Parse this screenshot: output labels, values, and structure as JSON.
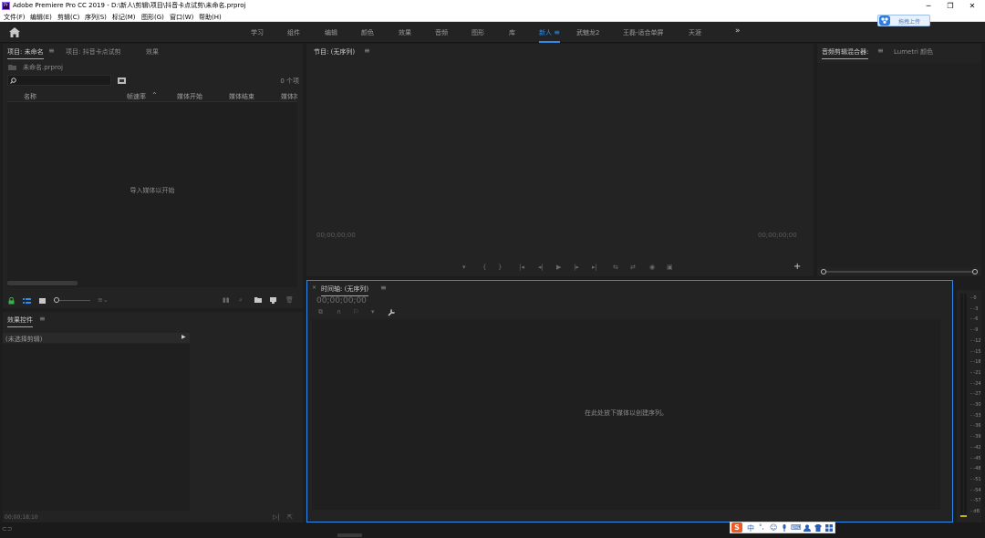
{
  "window": {
    "title": "Adobe Premiere Pro CC 2019 - D:\\新人\\剪辑\\项目\\抖音卡点试剪\\未命名.prproj",
    "app_icon": "Pr",
    "controls": {
      "minimize": "─",
      "restore": "❐",
      "close": "✕"
    }
  },
  "menu": [
    "文件(F)",
    "编辑(E)",
    "剪辑(C)",
    "序列(S)",
    "标记(M)",
    "图形(G)",
    "窗口(W)",
    "帮助(H)"
  ],
  "workspaces": {
    "home_icon": "home-icon",
    "items": [
      "学习",
      "组件",
      "编辑",
      "颜色",
      "效果",
      "音频",
      "图形",
      "库",
      "新人",
      "武魅龙2",
      "王磊-适合单屏",
      "天涯"
    ],
    "active": "新人",
    "more": "»"
  },
  "upload_widget": {
    "label": "拖拽上传"
  },
  "project_panel": {
    "tabs": [
      "项目: 未命名",
      "项目: 抖音卡点试剪",
      "效果"
    ],
    "project_file": "未命名.prproj",
    "search_placeholder": "",
    "item_count": "0 个项",
    "columns": [
      "名称",
      "帧速率",
      "媒体开始",
      "媒体结束",
      "媒体持"
    ],
    "empty_message": "导入媒体以开始"
  },
  "program_monitor": {
    "tab": "节目: (无序列)",
    "timecode_left": "00;00;00;00",
    "timecode_right": "00;00;00;00",
    "controls": [
      "▾",
      "{",
      "}",
      "|◂",
      "◂|",
      "▶",
      "|▸",
      "▸|",
      "⇆",
      "⇄",
      "◉",
      "▣"
    ],
    "add": "+"
  },
  "audio_mixer": {
    "tabs": [
      "音频剪辑混合器:",
      "Lumetri 颜色"
    ]
  },
  "effect_controls": {
    "tab": "效果控件",
    "no_clip": "(未选择剪辑)",
    "timecode": "00;00;18;10"
  },
  "timeline": {
    "tab": "时间轴: (无序列)",
    "timecode": "00;00;00;00",
    "empty_message": "在此处放下媒体以创建序列。"
  },
  "audio_meter": {
    "labels": [
      "0",
      "-3",
      "-6",
      "-9",
      "-12",
      "-15",
      "-18",
      "-21",
      "-24",
      "-27",
      "-30",
      "-33",
      "-36",
      "-39",
      "-42",
      "-45",
      "-48",
      "-51",
      "-54",
      "-57",
      "dB"
    ]
  },
  "ime_bar": {
    "logo": "S",
    "items": [
      "中",
      "°,",
      "☺",
      "🎤",
      "⌨",
      "👕",
      "▦"
    ]
  },
  "colors": {
    "accent": "#2d8ceb",
    "panel_bg": "#232323",
    "app_bg": "#1d1d1d"
  }
}
